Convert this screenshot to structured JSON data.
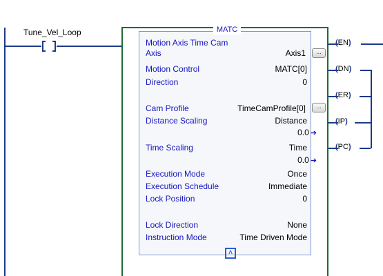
{
  "rung": {
    "tag": "Tune_Vel_Loop"
  },
  "instruction": {
    "mnemonic": "MATC",
    "title": "Motion Axis Time Cam",
    "fields": [
      {
        "label": "Axis",
        "value": "Axis1"
      },
      {
        "label": "Motion Control",
        "value": "MATC[0]"
      },
      {
        "label": "Direction",
        "value": "0"
      },
      {
        "label": "Cam Profile",
        "value": "TimeCamProfile[0]"
      },
      {
        "label": "Distance Scaling",
        "value": "Distance",
        "sub": "0.0"
      },
      {
        "label": "Time Scaling",
        "value": "Time",
        "sub": "0.0"
      },
      {
        "label": "Execution Mode",
        "value": "Once"
      },
      {
        "label": "Execution Schedule",
        "value": "Immediate"
      },
      {
        "label": "Lock Position",
        "value": "0"
      },
      {
        "label": "Lock Direction",
        "value": "None"
      },
      {
        "label": "Instruction Mode",
        "value": "Time Driven Mode"
      }
    ],
    "ellipsis": "...",
    "collapse_icon": "double-chevron-up-icon",
    "outputs": [
      "EN",
      "DN",
      "ER",
      "IP",
      "PC"
    ]
  },
  "colors": {
    "rail": "#1b3a8a",
    "box_border": "#1f6b34",
    "label_text": "#1616c0"
  }
}
